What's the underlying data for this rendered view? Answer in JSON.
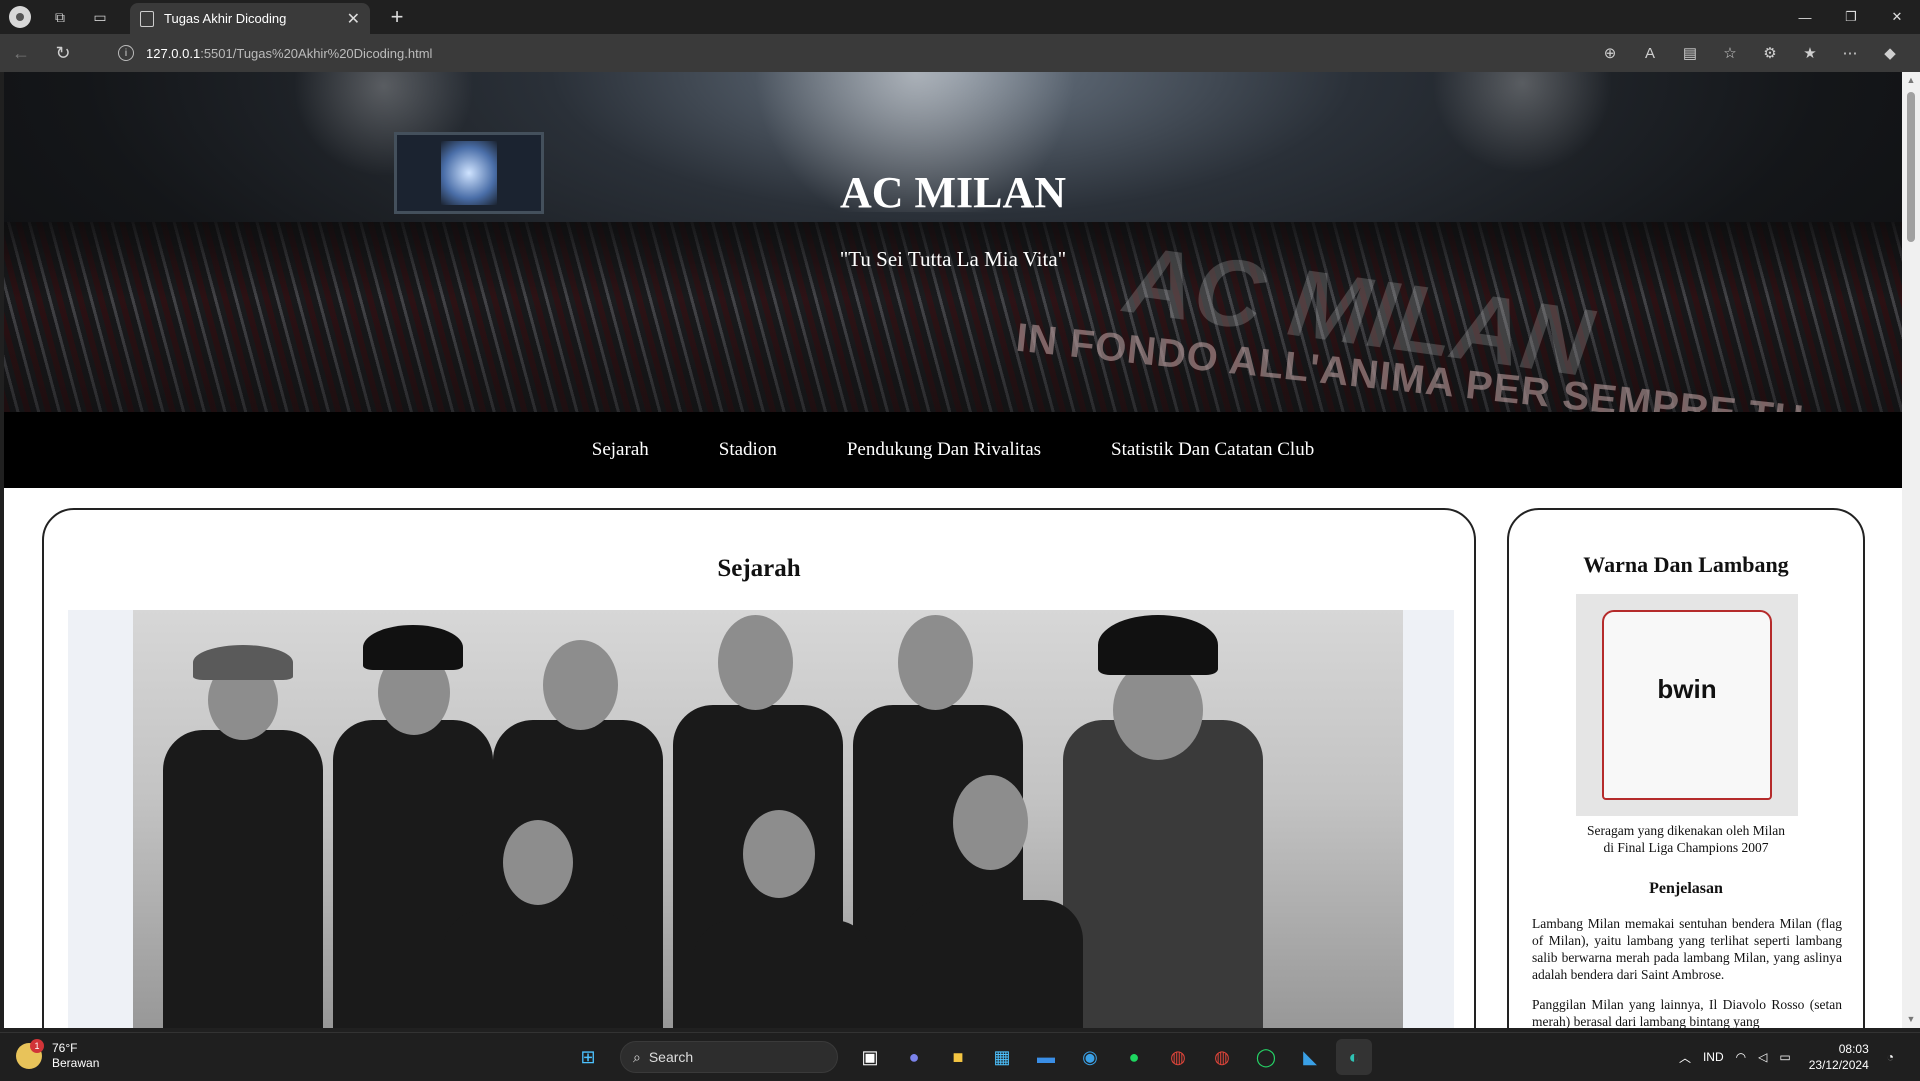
{
  "browser": {
    "tab_title": "Tugas Akhir Dicoding",
    "url_host": "127.0.0.1",
    "url_rest": ":5501/Tugas%20Akhir%20Dicoding.html"
  },
  "hero": {
    "title": "AC MILAN",
    "tagline": "\"Tu Sei Tutta La Mia Vita\"",
    "banner_main": "AC MILAN",
    "banner_sub": "IN FONDO ALL'ANIMA PER SEMPRE TU"
  },
  "nav": {
    "items": [
      {
        "label": "Sejarah"
      },
      {
        "label": "Stadion"
      },
      {
        "label": "Pendukung Dan Rivalitas"
      },
      {
        "label": "Statistik Dan Catatan Club"
      }
    ]
  },
  "main": {
    "heading": "Sejarah"
  },
  "aside": {
    "heading": "Warna Dan Lambang",
    "jersey_sponsor": "bwin",
    "caption_line1": "Seragam yang dikenakan oleh Milan",
    "caption_line2": "di Final Liga Champions 2007",
    "subheading": "Penjelasan",
    "paragraph1": "Lambang Milan memakai sentuhan bendera Milan (flag of Milan), yaitu lambang yang terlihat seperti lambang salib berwarna merah pada lambang Milan, yang aslinya adalah bendera dari Saint Ambrose.",
    "paragraph2": "Panggilan Milan yang lainnya, Il Diavolo Rosso (setan merah) berasal dari lambang bintang yang"
  },
  "taskbar": {
    "weather_temp": "76°F",
    "weather_desc": "Berawan",
    "weather_badge": "1",
    "search_label": "Search",
    "language": "IND",
    "time": "08:03",
    "date": "23/12/2024"
  },
  "colors": {
    "nav_bg": "#000000",
    "page_bg": "#ffffff",
    "accent_red": "#b52b2b"
  }
}
